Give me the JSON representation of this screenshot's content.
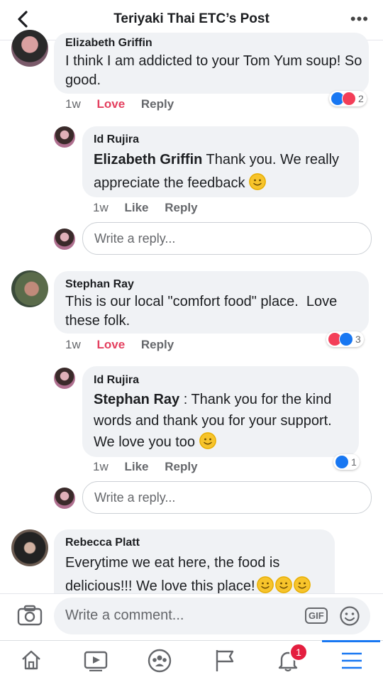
{
  "header": {
    "title": "Teriyaki Thai ETC’s Post",
    "more_label": "•••"
  },
  "comments": [
    {
      "author": "Elizabeth Griffin",
      "text": "I think I am addicted to your Tom Yum soup! So good.",
      "time": "1w",
      "like_label": "Love",
      "reply_label": "Reply",
      "reaction_count": "2",
      "replies": [
        {
          "author": "Id Rujira",
          "mention": "Elizabeth Griffin",
          "text": " Thank you. We really appreciate the feedback ",
          "time": "1w",
          "like_label": "Like",
          "reply_label": "Reply"
        }
      ],
      "reply_placeholder": "Write a reply..."
    },
    {
      "author": "Stephan Ray",
      "text": "This is our local \"comfort food\" place.  Love these folk.",
      "time": "1w",
      "like_label": "Love",
      "reply_label": "Reply",
      "reaction_count": "3",
      "replies": [
        {
          "author": "Id Rujira",
          "mention": "Stephan Ray",
          "text": " : Thank you for the kind words and thank you for your support. We love you too ",
          "time": "1w",
          "like_label": "Like",
          "reply_label": "Reply",
          "reaction_count": "1"
        }
      ],
      "reply_placeholder": "Write a reply..."
    },
    {
      "author": "Rebecca Platt",
      "text": "Everytime we eat here, the food is delicious!!! We love this place!"
    }
  ],
  "composer": {
    "placeholder": "Write a comment...",
    "gif_label": "GIF"
  },
  "tabbar": {
    "notification_count": "1"
  },
  "colors": {
    "accent": "#1877f2",
    "love": "#f33e58",
    "bubble": "#f0f2f5"
  }
}
